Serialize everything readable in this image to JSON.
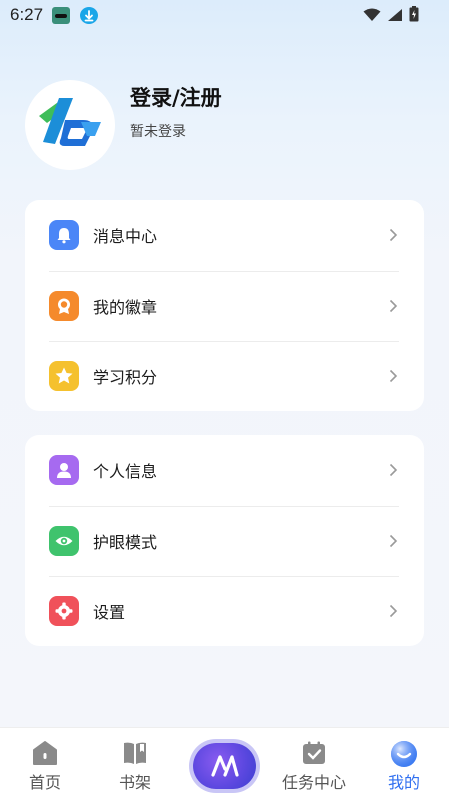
{
  "status_bar": {
    "time": "6:27"
  },
  "profile": {
    "title": "登录/注册",
    "subtitle": "暂未登录"
  },
  "card1": {
    "items": [
      {
        "label": "消息中心",
        "icon": "bell-icon",
        "color": "#4b86f7"
      },
      {
        "label": "我的徽章",
        "icon": "badge-icon",
        "color": "#f58a2c"
      },
      {
        "label": "学习积分",
        "icon": "star-icon",
        "color": "#f5c12e"
      }
    ]
  },
  "card2": {
    "items": [
      {
        "label": "个人信息",
        "icon": "person-icon",
        "color": "#a66af0"
      },
      {
        "label": "护眼模式",
        "icon": "eye-icon",
        "color": "#3fc36d"
      },
      {
        "label": "设置",
        "icon": "gear-icon",
        "color": "#f0515a"
      }
    ]
  },
  "nav": {
    "items": [
      {
        "label": "首页",
        "icon": "home-icon"
      },
      {
        "label": "书架",
        "icon": "book-icon"
      },
      {
        "label": "任务中心",
        "icon": "task-icon"
      },
      {
        "label": "我的",
        "icon": "profile-icon",
        "active": true
      }
    ],
    "accent": "#2f6ff0"
  }
}
